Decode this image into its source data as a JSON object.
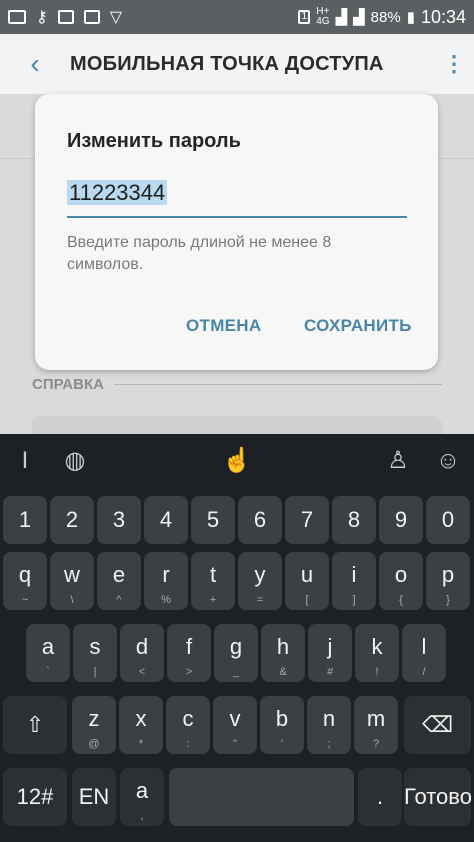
{
  "statusbar": {
    "battery": "88%",
    "time": "10:34",
    "net1": "H+",
    "net2": "4G"
  },
  "appbar": {
    "title": "МОБИЛЬНАЯ ТОЧКА ДОСТУПА"
  },
  "background": {
    "section": "СПРАВКА"
  },
  "dialog": {
    "title": "Изменить пароль",
    "password_value": "11223344",
    "hint": "Введите пароль длиной не менее 8 символов.",
    "cancel": "ОТМЕНА",
    "save": "СОХРАНИТЬ"
  },
  "keyboard": {
    "toolbar": [
      "text-cursor-icon",
      "globe-icon",
      "gesture-icon",
      "shirt-icon",
      "emoji-icon"
    ],
    "row_numbers": [
      "1",
      "2",
      "3",
      "4",
      "5",
      "6",
      "7",
      "8",
      "9",
      "0"
    ],
    "row1": [
      {
        "m": "q",
        "s": "~"
      },
      {
        "m": "w",
        "s": "\\"
      },
      {
        "m": "e",
        "s": "^"
      },
      {
        "m": "r",
        "s": "%"
      },
      {
        "m": "t",
        "s": "+"
      },
      {
        "m": "y",
        "s": "="
      },
      {
        "m": "u",
        "s": "["
      },
      {
        "m": "i",
        "s": "]"
      },
      {
        "m": "o",
        "s": "{"
      },
      {
        "m": "p",
        "s": "}"
      }
    ],
    "row2": [
      {
        "m": "a",
        "s": "`"
      },
      {
        "m": "s",
        "s": "|"
      },
      {
        "m": "d",
        "s": "<"
      },
      {
        "m": "f",
        "s": ">"
      },
      {
        "m": "g",
        "s": "_"
      },
      {
        "m": "h",
        "s": "&"
      },
      {
        "m": "j",
        "s": "#"
      },
      {
        "m": "k",
        "s": "!"
      },
      {
        "m": "l",
        "s": "/"
      }
    ],
    "row3": [
      {
        "m": "z",
        "s": "@"
      },
      {
        "m": "x",
        "s": "*"
      },
      {
        "m": "c",
        "s": ":"
      },
      {
        "m": "v",
        "s": "\""
      },
      {
        "m": "b",
        "s": "'"
      },
      {
        "m": "n",
        "s": ";"
      },
      {
        "m": "m",
        "s": "?"
      }
    ],
    "sym": "12#",
    "lang": "EN",
    "comma_top": "a",
    "comma": ",",
    "period": ".",
    "done": "Готово"
  }
}
